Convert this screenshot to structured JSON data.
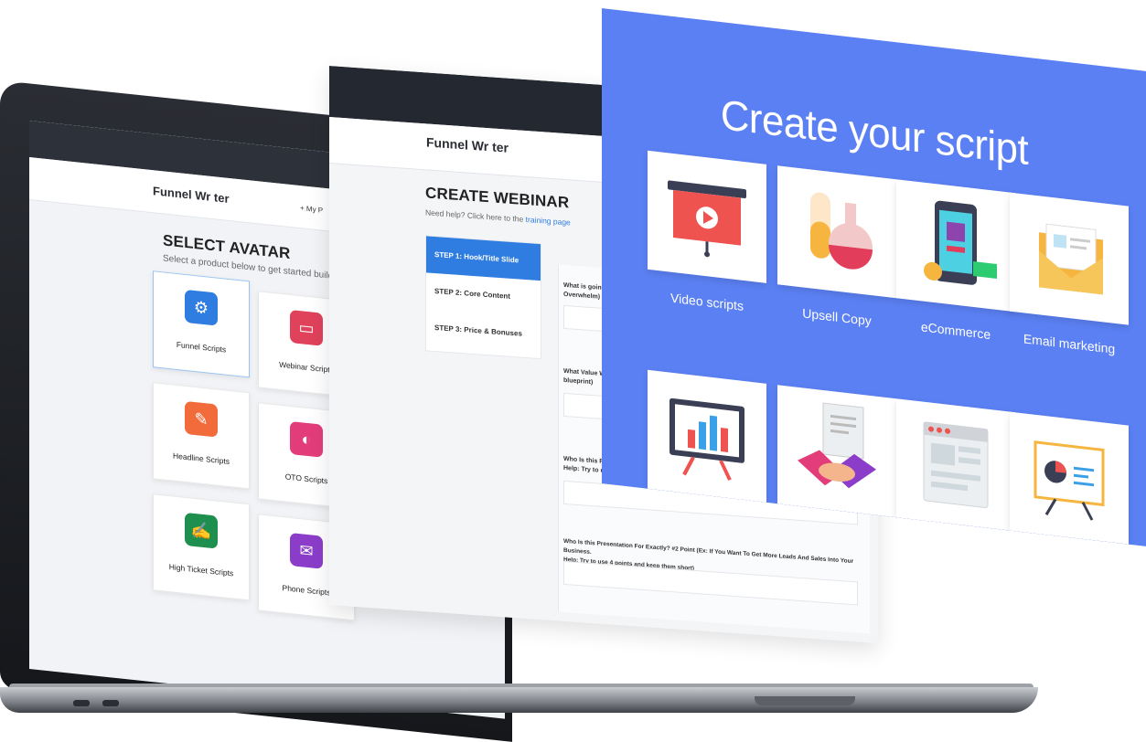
{
  "laptop": {
    "logo": "Funnel Wr ter",
    "menu": "My P",
    "title": "SELECT AVATAR",
    "subtitle": "Select a product below to get started building your p",
    "cards": [
      {
        "label": "Funnel Scripts",
        "color": "#2f7de1",
        "icon": "gear-icon",
        "glyph": "⚙"
      },
      {
        "label": "Webinar Scripts",
        "color": "#e0415b",
        "icon": "laptop-icon",
        "glyph": "▭"
      },
      {
        "label": "Headline Scripts",
        "color": "#f26b3a",
        "icon": "edit-icon",
        "glyph": "✎"
      },
      {
        "label": "OTO Scripts",
        "color": "#e23d7a",
        "icon": "gauge-icon",
        "glyph": "◐"
      },
      {
        "label": "High Ticket Scripts",
        "color": "#1e8f4e",
        "icon": "document-icon",
        "glyph": "✍"
      },
      {
        "label": "Phone Scripts",
        "color": "#8b3dc9",
        "icon": "chat-icon",
        "glyph": "✉"
      }
    ]
  },
  "webinar": {
    "logo": "Funnel Wr ter",
    "title": "CREATE WEBINAR",
    "help_prefix": "Need help? Click here to the",
    "help_link": "training page",
    "steps": [
      "STEP 1: Hook/Title Slide",
      "STEP 2: Core Content",
      "STEP 3: Price & Bonuses"
    ],
    "questions": [
      {
        "line1": "What is going",
        "line2": "Overwhelm)"
      },
      {
        "line1": "What Value W",
        "line2": "blueprint)"
      },
      {
        "line1": "Who Is this Pr",
        "line2": "Help: Try to us"
      },
      {
        "line1": "Who Is this Presentation For Exactly? #2 Point (Ex: If You Want To Get More Leads And Sales Into Your Business.",
        "line2": "Help: Try to use 4 points and keep them short)"
      }
    ]
  },
  "create_panel": {
    "title": "Create your script",
    "bg_color": "#5b80f3",
    "tiles": [
      {
        "label": "Video scripts",
        "icon": "presentation-play-icon"
      },
      {
        "label": "Upsell Copy",
        "icon": "potion-flasks-icon"
      },
      {
        "label": "eCommerce",
        "icon": "smartphone-shop-icon"
      },
      {
        "label": "Email marketing",
        "icon": "envelope-icon"
      },
      {
        "label": "",
        "icon": "bar-chart-board-icon"
      },
      {
        "label": "",
        "icon": "handshake-contract-icon"
      },
      {
        "label": "",
        "icon": "browser-layout-icon"
      },
      {
        "label": "",
        "icon": "pie-chart-easel-icon"
      }
    ]
  }
}
